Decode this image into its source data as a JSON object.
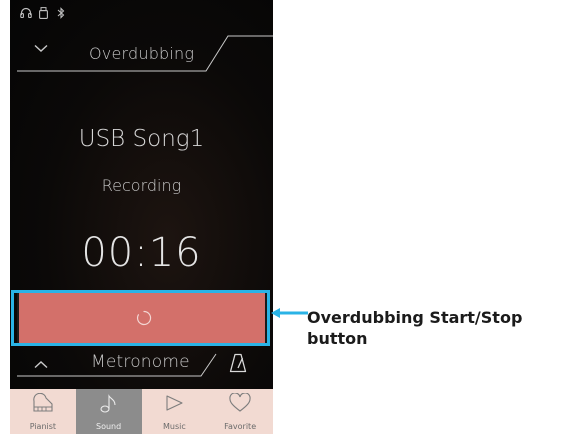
{
  "header": {
    "title": "Overdubbing"
  },
  "song": {
    "name": "USB Song1",
    "status": "Recording",
    "elapsed": "00:16"
  },
  "metronome": {
    "title": "Metronome"
  },
  "nav": {
    "tabs": [
      {
        "label": "Pianist",
        "icon": "piano-icon",
        "active": false
      },
      {
        "label": "Sound",
        "icon": "music-note-icon",
        "active": true
      },
      {
        "label": "Music",
        "icon": "play-icon",
        "active": false
      },
      {
        "label": "Favorite",
        "icon": "heart-icon",
        "active": false
      }
    ]
  },
  "status_icons": [
    "headphones-icon",
    "usb-drive-icon",
    "bluetooth-icon"
  ],
  "callout": {
    "line1": "Overdubbing Start/Stop",
    "line2": "button"
  },
  "colors": {
    "button": "#d3706a",
    "highlight": "#2ab3e6",
    "nav_background": "#f2dad2",
    "nav_active": "#8c8c8c"
  }
}
